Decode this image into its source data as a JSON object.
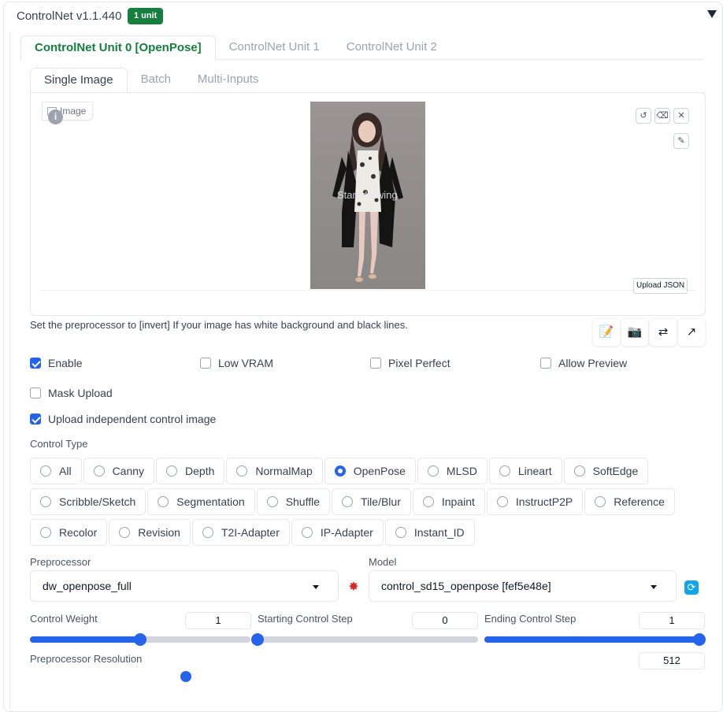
{
  "accordion": {
    "title": "ControlNet v1.1.440",
    "badge": "1 unit"
  },
  "unit_tabs": [
    "ControlNet Unit 0 [OpenPose]",
    "ControlNet Unit 1",
    "ControlNet Unit 2"
  ],
  "input_tabs": [
    "Single Image",
    "Batch",
    "Multi-Inputs"
  ],
  "image_panel": {
    "label": "Image",
    "info": "i",
    "overlay_text": "Start drawing",
    "upload_json": "Upload JSON"
  },
  "hint": "Set the preprocessor to [invert] If your image has white background and black lines.",
  "checkboxes": {
    "enable": {
      "label": "Enable",
      "checked": true
    },
    "low_vram": {
      "label": "Low VRAM",
      "checked": false
    },
    "pixel_perfect": {
      "label": "Pixel Perfect",
      "checked": false
    },
    "allow_preview": {
      "label": "Allow Preview",
      "checked": false
    },
    "mask_upload": {
      "label": "Mask Upload",
      "checked": false
    },
    "upload_independent": {
      "label": "Upload independent control image",
      "checked": true
    }
  },
  "control_type": {
    "label": "Control Type",
    "selected": "OpenPose",
    "rows": [
      [
        "All",
        "Canny",
        "Depth",
        "NormalMap",
        "OpenPose",
        "MLSD",
        "Lineart",
        "SoftEdge"
      ],
      [
        "Scribble/Sketch",
        "Segmentation",
        "Shuffle",
        "Tile/Blur",
        "Inpaint",
        "InstructP2P",
        "Reference"
      ],
      [
        "Recolor",
        "Revision",
        "T2I-Adapter",
        "IP-Adapter",
        "Instant_ID"
      ]
    ]
  },
  "preprocessor": {
    "label": "Preprocessor",
    "value": "dw_openpose_full"
  },
  "model": {
    "label": "Model",
    "value": "control_sd15_openpose [fef5e48e]"
  },
  "sliders": {
    "control_weight": {
      "label": "Control Weight",
      "value": "1",
      "fraction": 0.5
    },
    "starting_step": {
      "label": "Starting Control Step",
      "value": "0",
      "fraction": 0.0
    },
    "ending_step": {
      "label": "Ending Control Step",
      "value": "1",
      "fraction": 1.0
    },
    "preprocessor_resolution": {
      "label": "Preprocessor Resolution",
      "value": "512"
    }
  },
  "colors": {
    "accent": "#2563eb",
    "badge": "#15803d",
    "active_tab": "#15803d"
  }
}
